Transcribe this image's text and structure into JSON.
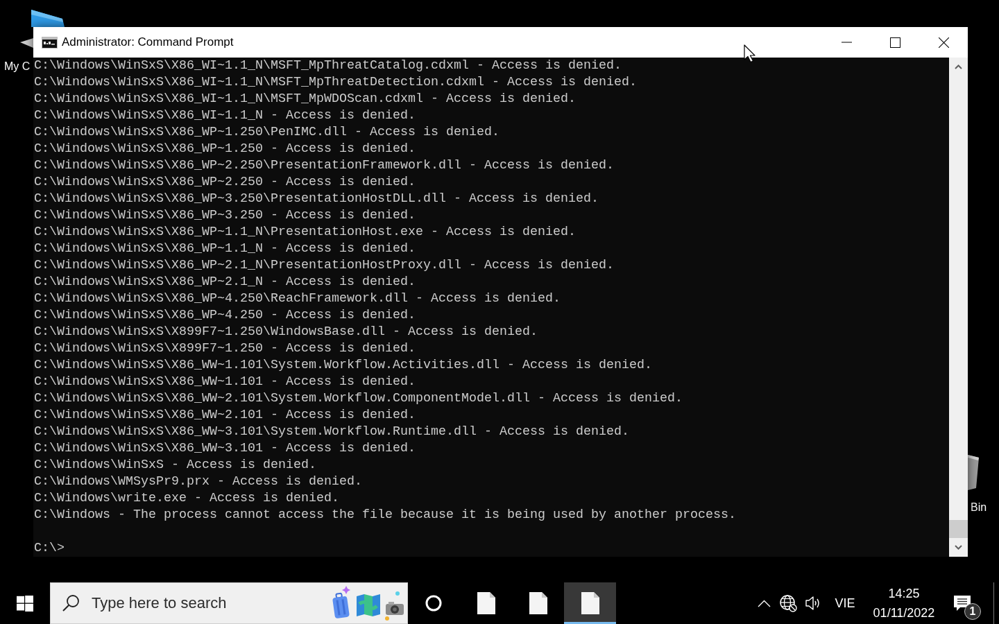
{
  "desktop": {
    "icons": [
      {
        "kind": "computer",
        "label": "My C"
      },
      {
        "kind": "recycle_bin",
        "label": "Bin"
      }
    ]
  },
  "window": {
    "title": "Administrator: Command Prompt",
    "lines": [
      "C:\\Windows\\WinSxS\\X86_WI~1.1_N\\MSFT_MpThreatCatalog.cdxml - Access is denied.",
      "C:\\Windows\\WinSxS\\X86_WI~1.1_N\\MSFT_MpThreatDetection.cdxml - Access is denied.",
      "C:\\Windows\\WinSxS\\X86_WI~1.1_N\\MSFT_MpWDOScan.cdxml - Access is denied.",
      "C:\\Windows\\WinSxS\\X86_WI~1.1_N - Access is denied.",
      "C:\\Windows\\WinSxS\\X86_WP~1.250\\PenIMC.dll - Access is denied.",
      "C:\\Windows\\WinSxS\\X86_WP~1.250 - Access is denied.",
      "C:\\Windows\\WinSxS\\X86_WP~2.250\\PresentationFramework.dll - Access is denied.",
      "C:\\Windows\\WinSxS\\X86_WP~2.250 - Access is denied.",
      "C:\\Windows\\WinSxS\\X86_WP~3.250\\PresentationHostDLL.dll - Access is denied.",
      "C:\\Windows\\WinSxS\\X86_WP~3.250 - Access is denied.",
      "C:\\Windows\\WinSxS\\X86_WP~1.1_N\\PresentationHost.exe - Access is denied.",
      "C:\\Windows\\WinSxS\\X86_WP~1.1_N - Access is denied.",
      "C:\\Windows\\WinSxS\\X86_WP~2.1_N\\PresentationHostProxy.dll - Access is denied.",
      "C:\\Windows\\WinSxS\\X86_WP~2.1_N - Access is denied.",
      "C:\\Windows\\WinSxS\\X86_WP~4.250\\ReachFramework.dll - Access is denied.",
      "C:\\Windows\\WinSxS\\X86_WP~4.250 - Access is denied.",
      "C:\\Windows\\WinSxS\\X899F7~1.250\\WindowsBase.dll - Access is denied.",
      "C:\\Windows\\WinSxS\\X899F7~1.250 - Access is denied.",
      "C:\\Windows\\WinSxS\\X86_WW~1.101\\System.Workflow.Activities.dll - Access is denied.",
      "C:\\Windows\\WinSxS\\X86_WW~1.101 - Access is denied.",
      "C:\\Windows\\WinSxS\\X86_WW~2.101\\System.Workflow.ComponentModel.dll - Access is denied.",
      "C:\\Windows\\WinSxS\\X86_WW~2.101 - Access is denied.",
      "C:\\Windows\\WinSxS\\X86_WW~3.101\\System.Workflow.Runtime.dll - Access is denied.",
      "C:\\Windows\\WinSxS\\X86_WW~3.101 - Access is denied.",
      "C:\\Windows\\WinSxS - Access is denied.",
      "C:\\Windows\\WMSysPr9.prx - Access is denied.",
      "C:\\Windows\\write.exe - Access is denied.",
      "C:\\Windows - The process cannot access the file because it is being used by another process."
    ],
    "prompt": "C:\\>"
  },
  "taskbar": {
    "search": {
      "placeholder": "Type here to search"
    },
    "apps": [
      {
        "selected": false
      },
      {
        "selected": false
      },
      {
        "selected": true
      }
    ],
    "tray": {
      "language": "VIE",
      "time": "14:25",
      "date": "01/11/2022",
      "notifications": "1"
    }
  }
}
